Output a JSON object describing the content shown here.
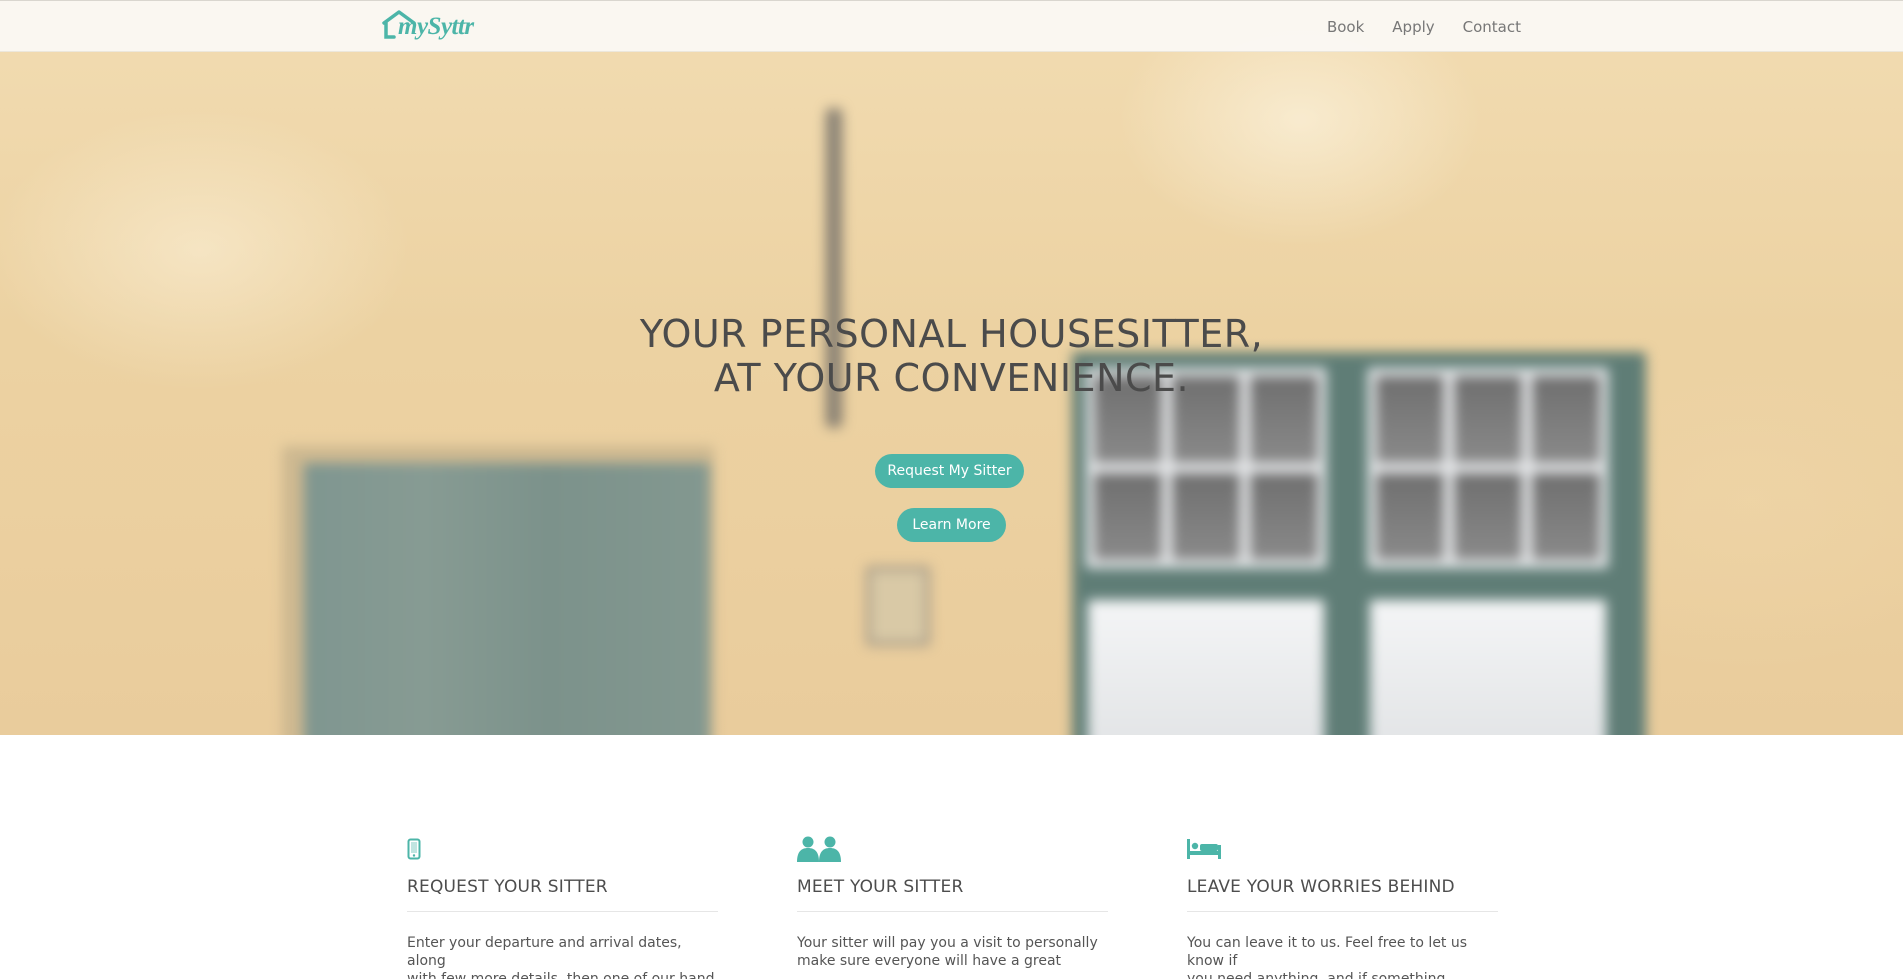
{
  "brand": {
    "name": "mySyttr",
    "color": "#4cb5a8"
  },
  "nav": {
    "items": [
      {
        "label": "Book"
      },
      {
        "label": "Apply"
      },
      {
        "label": "Contact"
      }
    ]
  },
  "hero": {
    "title_line1": "YOUR PERSONAL HOUSESITTER,",
    "title_line2": "AT YOUR CONVENIENCE.",
    "primary_button": "Request My Sitter",
    "secondary_button": "Learn More"
  },
  "features": [
    {
      "icon": "mobile-phone-icon",
      "title": "REQUEST YOUR SITTER",
      "text_line1": "Enter your departure and arrival dates, along",
      "text_line2": "with few more details, then one of our hand"
    },
    {
      "icon": "people-icon",
      "title": "MEET YOUR SITTER",
      "text_line1": "Your sitter will pay you a visit to personally",
      "text_line2": "make sure everyone will have a great"
    },
    {
      "icon": "bed-icon",
      "title": "LEAVE YOUR WORRIES BEHIND",
      "text_line1": "You can leave it to us. Feel free to let us know if",
      "text_line2": "you need anything, and if something doesn't go"
    }
  ],
  "colors": {
    "accent": "#4cb5a8",
    "heading": "#4b4b4b",
    "nav_text": "#777777"
  }
}
